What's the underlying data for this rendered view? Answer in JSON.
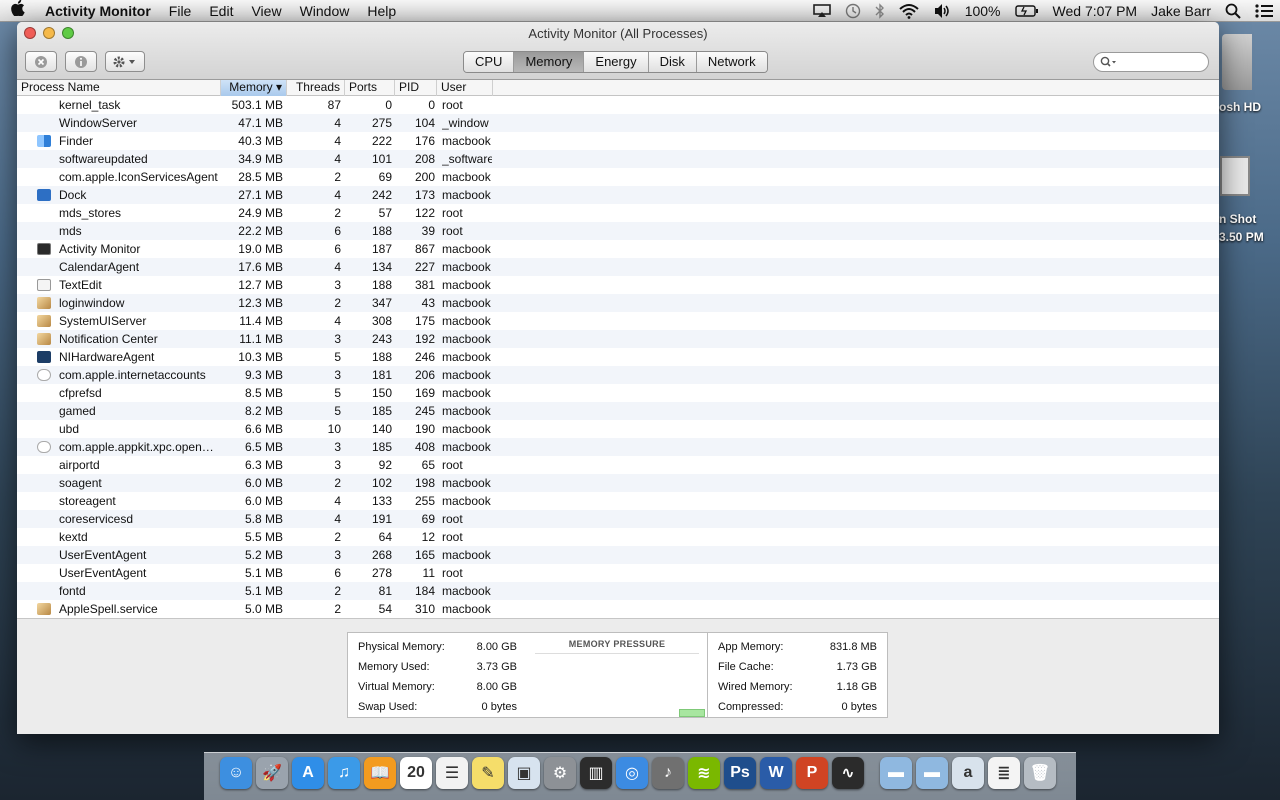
{
  "menubar": {
    "app": "Activity Monitor",
    "menus": [
      "File",
      "Edit",
      "View",
      "Window",
      "Help"
    ],
    "battery": "100%",
    "clock": "Wed 7:07 PM",
    "user": "Jake Barr"
  },
  "desktop": {
    "hd_label": "osh HD",
    "shot_label1": "n Shot",
    "shot_label2": "3.50 PM"
  },
  "window": {
    "title": "Activity Monitor (All Processes)",
    "tabs": [
      "CPU",
      "Memory",
      "Energy",
      "Disk",
      "Network"
    ],
    "active_tab": "Memory",
    "search_placeholder": ""
  },
  "columns": [
    "Process Name",
    "Memory ▾",
    "Threads",
    "Ports",
    "PID",
    "User"
  ],
  "processes": [
    {
      "name": "kernel_task",
      "mem": "503.1 MB",
      "threads": "87",
      "ports": "0",
      "pid": "0",
      "user": "root",
      "icon": ""
    },
    {
      "name": "WindowServer",
      "mem": "47.1 MB",
      "threads": "4",
      "ports": "275",
      "pid": "104",
      "user": "_window",
      "icon": ""
    },
    {
      "name": "Finder",
      "mem": "40.3 MB",
      "threads": "4",
      "ports": "222",
      "pid": "176",
      "user": "macbook",
      "icon": "finder-icon"
    },
    {
      "name": "softwareupdated",
      "mem": "34.9 MB",
      "threads": "4",
      "ports": "101",
      "pid": "208",
      "user": "_software",
      "icon": ""
    },
    {
      "name": "com.apple.IconServicesAgent",
      "mem": "28.5 MB",
      "threads": "2",
      "ports": "69",
      "pid": "200",
      "user": "macbook",
      "icon": ""
    },
    {
      "name": "Dock",
      "mem": "27.1 MB",
      "threads": "4",
      "ports": "242",
      "pid": "173",
      "user": "macbook",
      "icon": "dock-icon"
    },
    {
      "name": "mds_stores",
      "mem": "24.9 MB",
      "threads": "2",
      "ports": "57",
      "pid": "122",
      "user": "root",
      "icon": ""
    },
    {
      "name": "mds",
      "mem": "22.2 MB",
      "threads": "6",
      "ports": "188",
      "pid": "39",
      "user": "root",
      "icon": ""
    },
    {
      "name": "Activity Monitor",
      "mem": "19.0 MB",
      "threads": "6",
      "ports": "187",
      "pid": "867",
      "user": "macbook",
      "icon": "activity-monitor-icon"
    },
    {
      "name": "CalendarAgent",
      "mem": "17.6 MB",
      "threads": "4",
      "ports": "134",
      "pid": "227",
      "user": "macbook",
      "icon": ""
    },
    {
      "name": "TextEdit",
      "mem": "12.7 MB",
      "threads": "3",
      "ports": "188",
      "pid": "381",
      "user": "macbook",
      "icon": "textedit-icon"
    },
    {
      "name": "loginwindow",
      "mem": "12.3 MB",
      "threads": "2",
      "ports": "347",
      "pid": "43",
      "user": "macbook",
      "icon": "app-icon"
    },
    {
      "name": "SystemUIServer",
      "mem": "11.4 MB",
      "threads": "4",
      "ports": "308",
      "pid": "175",
      "user": "macbook",
      "icon": "app-icon"
    },
    {
      "name": "Notification Center",
      "mem": "11.1 MB",
      "threads": "3",
      "ports": "243",
      "pid": "192",
      "user": "macbook",
      "icon": "app-icon"
    },
    {
      "name": "NIHardwareAgent",
      "mem": "10.3 MB",
      "threads": "5",
      "ports": "188",
      "pid": "246",
      "user": "macbook",
      "icon": "ni-icon"
    },
    {
      "name": "com.apple.internetaccounts",
      "mem": "9.3 MB",
      "threads": "3",
      "ports": "181",
      "pid": "206",
      "user": "macbook",
      "icon": "shield-icon"
    },
    {
      "name": "cfprefsd",
      "mem": "8.5 MB",
      "threads": "5",
      "ports": "150",
      "pid": "169",
      "user": "macbook",
      "icon": ""
    },
    {
      "name": "gamed",
      "mem": "8.2 MB",
      "threads": "5",
      "ports": "185",
      "pid": "245",
      "user": "macbook",
      "icon": ""
    },
    {
      "name": "ubd",
      "mem": "6.6 MB",
      "threads": "10",
      "ports": "140",
      "pid": "190",
      "user": "macbook",
      "icon": ""
    },
    {
      "name": "com.apple.appkit.xpc.open…",
      "mem": "6.5 MB",
      "threads": "3",
      "ports": "185",
      "pid": "408",
      "user": "macbook",
      "icon": "shield-icon"
    },
    {
      "name": "airportd",
      "mem": "6.3 MB",
      "threads": "3",
      "ports": "92",
      "pid": "65",
      "user": "root",
      "icon": ""
    },
    {
      "name": "soagent",
      "mem": "6.0 MB",
      "threads": "2",
      "ports": "102",
      "pid": "198",
      "user": "macbook",
      "icon": ""
    },
    {
      "name": "storeagent",
      "mem": "6.0 MB",
      "threads": "4",
      "ports": "133",
      "pid": "255",
      "user": "macbook",
      "icon": ""
    },
    {
      "name": "coreservicesd",
      "mem": "5.8 MB",
      "threads": "4",
      "ports": "191",
      "pid": "69",
      "user": "root",
      "icon": ""
    },
    {
      "name": "kextd",
      "mem": "5.5 MB",
      "threads": "2",
      "ports": "64",
      "pid": "12",
      "user": "root",
      "icon": ""
    },
    {
      "name": "UserEventAgent",
      "mem": "5.2 MB",
      "threads": "3",
      "ports": "268",
      "pid": "165",
      "user": "macbook",
      "icon": ""
    },
    {
      "name": "UserEventAgent",
      "mem": "5.1 MB",
      "threads": "6",
      "ports": "278",
      "pid": "11",
      "user": "root",
      "icon": ""
    },
    {
      "name": "fontd",
      "mem": "5.1 MB",
      "threads": "2",
      "ports": "81",
      "pid": "184",
      "user": "macbook",
      "icon": ""
    },
    {
      "name": "AppleSpell.service",
      "mem": "5.0 MB",
      "threads": "2",
      "ports": "54",
      "pid": "310",
      "user": "macbook",
      "icon": "app-icon"
    }
  ],
  "memory_stats": {
    "left": [
      {
        "label": "Physical Memory:",
        "value": "8.00 GB"
      },
      {
        "label": "Memory Used:",
        "value": "3.73 GB"
      },
      {
        "label": "Virtual Memory:",
        "value": "8.00 GB"
      },
      {
        "label": "Swap Used:",
        "value": "0 bytes"
      }
    ],
    "pressure_title": "MEMORY PRESSURE",
    "right": [
      {
        "label": "App Memory:",
        "value": "831.8 MB"
      },
      {
        "label": "File Cache:",
        "value": "1.73 GB"
      },
      {
        "label": "Wired Memory:",
        "value": "1.18 GB"
      },
      {
        "label": "Compressed:",
        "value": "0 bytes"
      }
    ]
  },
  "dock": {
    "icons": [
      {
        "name": "finder-icon",
        "color": "#3d8fe0",
        "glyph": "☺"
      },
      {
        "name": "launchpad-icon",
        "color": "#9aa3ad",
        "glyph": "🚀"
      },
      {
        "name": "app-store-icon",
        "color": "#2f8ee8",
        "glyph": "A"
      },
      {
        "name": "itunes-icon",
        "color": "#3b9ae8",
        "glyph": "♫"
      },
      {
        "name": "ibooks-icon",
        "color": "#f39b1f",
        "glyph": "📖"
      },
      {
        "name": "calendar-icon",
        "color": "#ffffff",
        "glyph": "20"
      },
      {
        "name": "reminders-icon",
        "color": "#f2f2f2",
        "glyph": "☰"
      },
      {
        "name": "notes-icon",
        "color": "#f5dd6a",
        "glyph": "✎"
      },
      {
        "name": "preview-icon",
        "color": "#d7e3ef",
        "glyph": "▣"
      },
      {
        "name": "system-preferences-icon",
        "color": "#8d9196",
        "glyph": "⚙"
      },
      {
        "name": "piano-icon",
        "color": "#2c2c2c",
        "glyph": "▥"
      },
      {
        "name": "safari-icon",
        "color": "#3c8be2",
        "glyph": "◎"
      },
      {
        "name": "garageband-icon",
        "color": "#707070",
        "glyph": "♪"
      },
      {
        "name": "spotify-icon",
        "color": "#7ab800",
        "glyph": "≋"
      },
      {
        "name": "photoshop-icon",
        "color": "#1f4e8c",
        "glyph": "Ps"
      },
      {
        "name": "word-icon",
        "color": "#2a5ca8",
        "glyph": "W"
      },
      {
        "name": "powerpoint-icon",
        "color": "#d04423",
        "glyph": "P"
      },
      {
        "name": "activity-monitor-icon",
        "color": "#2b2b2b",
        "glyph": "∿"
      },
      {
        "name": "applications-folder-icon",
        "color": "#8fb8e0",
        "glyph": "▬"
      },
      {
        "name": "documents-folder-icon",
        "color": "#8fb8e0",
        "glyph": "▬"
      },
      {
        "name": "downloads-stack-icon",
        "color": "#d8e2ec",
        "glyph": "a"
      },
      {
        "name": "document-stack-icon",
        "color": "#f4f4f4",
        "glyph": "≣"
      },
      {
        "name": "trash-icon",
        "color": "#b5bcc3",
        "glyph": "🗑"
      }
    ]
  }
}
